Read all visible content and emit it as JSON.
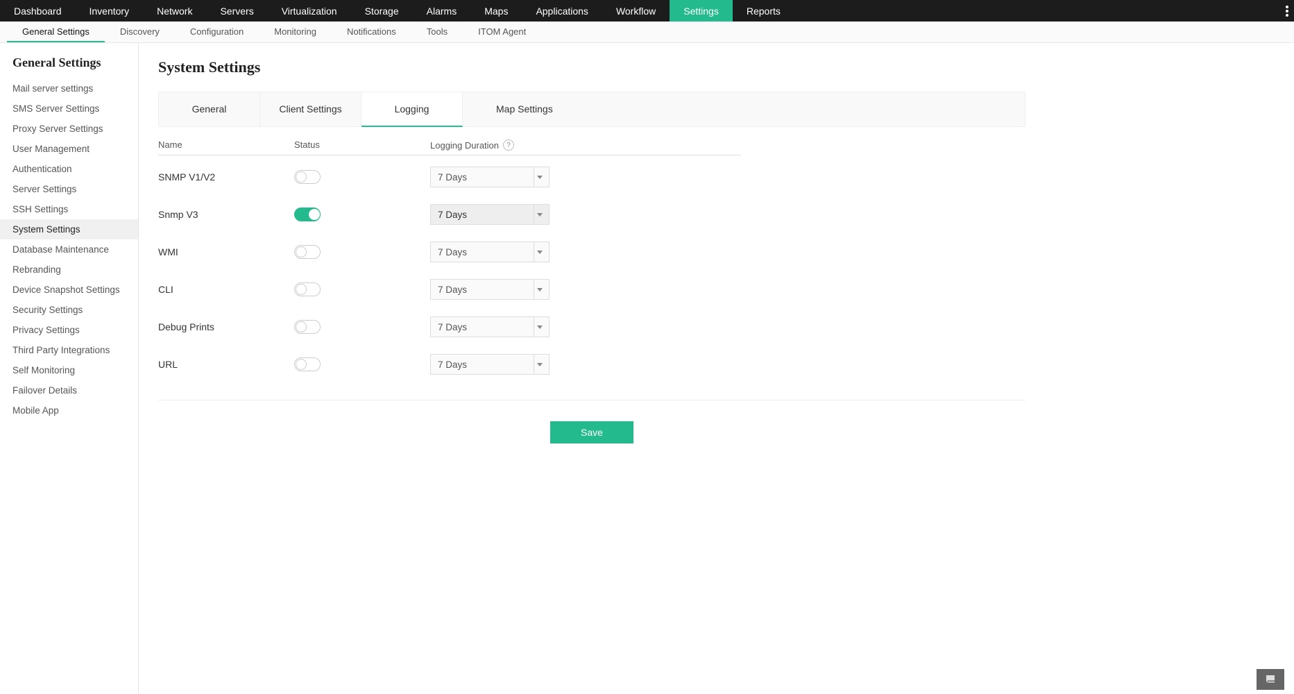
{
  "topnav": {
    "items": [
      "Dashboard",
      "Inventory",
      "Network",
      "Servers",
      "Virtualization",
      "Storage",
      "Alarms",
      "Maps",
      "Applications",
      "Workflow",
      "Settings",
      "Reports"
    ],
    "active_index": 10
  },
  "subnav": {
    "items": [
      "General Settings",
      "Discovery",
      "Configuration",
      "Monitoring",
      "Notifications",
      "Tools",
      "ITOM Agent"
    ],
    "active_index": 0
  },
  "sidebar": {
    "title": "General Settings",
    "items": [
      "Mail server settings",
      "SMS Server Settings",
      "Proxy Server Settings",
      "User Management",
      "Authentication",
      "Server Settings",
      "SSH Settings",
      "System Settings",
      "Database Maintenance",
      "Rebranding",
      "Device Snapshot Settings",
      "Security Settings",
      "Privacy Settings",
      "Third Party Integrations",
      "Self Monitoring",
      "Failover Details",
      "Mobile App"
    ],
    "active_index": 7
  },
  "page": {
    "title": "System Settings"
  },
  "tabs": {
    "items": [
      "General",
      "Client Settings",
      "Logging",
      "Map Settings"
    ],
    "active_index": 2
  },
  "columns": {
    "name": "Name",
    "status": "Status",
    "duration": "Logging Duration"
  },
  "help_symbol": "?",
  "rows": [
    {
      "name": "SNMP V1/V2",
      "on": false,
      "duration": "7 Days"
    },
    {
      "name": "Snmp V3",
      "on": true,
      "duration": "7 Days"
    },
    {
      "name": "WMI",
      "on": false,
      "duration": "7 Days"
    },
    {
      "name": "CLI",
      "on": false,
      "duration": "7 Days"
    },
    {
      "name": "Debug Prints",
      "on": false,
      "duration": "7 Days"
    },
    {
      "name": "URL",
      "on": false,
      "duration": "7 Days"
    }
  ],
  "save_label": "Save"
}
